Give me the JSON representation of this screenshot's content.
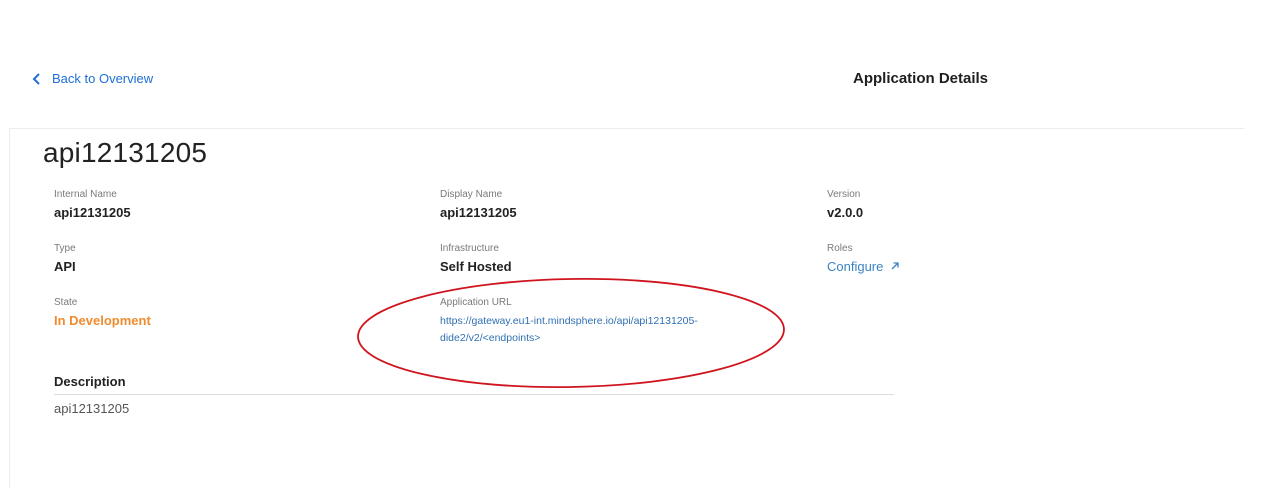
{
  "header": {
    "back_label": "Back to Overview",
    "title": "Application Details"
  },
  "app": {
    "title": "api12131205",
    "internal_name": {
      "label": "Internal Name",
      "value": "api12131205"
    },
    "display_name": {
      "label": "Display Name",
      "value": "api12131205"
    },
    "version": {
      "label": "Version",
      "value": "v2.0.0"
    },
    "type": {
      "label": "Type",
      "value": "API"
    },
    "infrastructure": {
      "label": "Infrastructure",
      "value": "Self Hosted"
    },
    "roles": {
      "label": "Roles",
      "value": "Configure"
    },
    "state": {
      "label": "State",
      "value": "In Development"
    },
    "application_url": {
      "label": "Application URL",
      "line1": "https://gateway.eu1-int.mindsphere.io/api/api12131205-",
      "line2": "dide2/v2/<endpoints>"
    },
    "description": {
      "label": "Description",
      "value": "api12131205"
    }
  },
  "colors": {
    "link": "#1d6fd6",
    "state": "#f08c2e",
    "annotation": "#d0141e"
  },
  "icons": {
    "back": "chevron-left-icon",
    "external": "external-link-icon"
  }
}
